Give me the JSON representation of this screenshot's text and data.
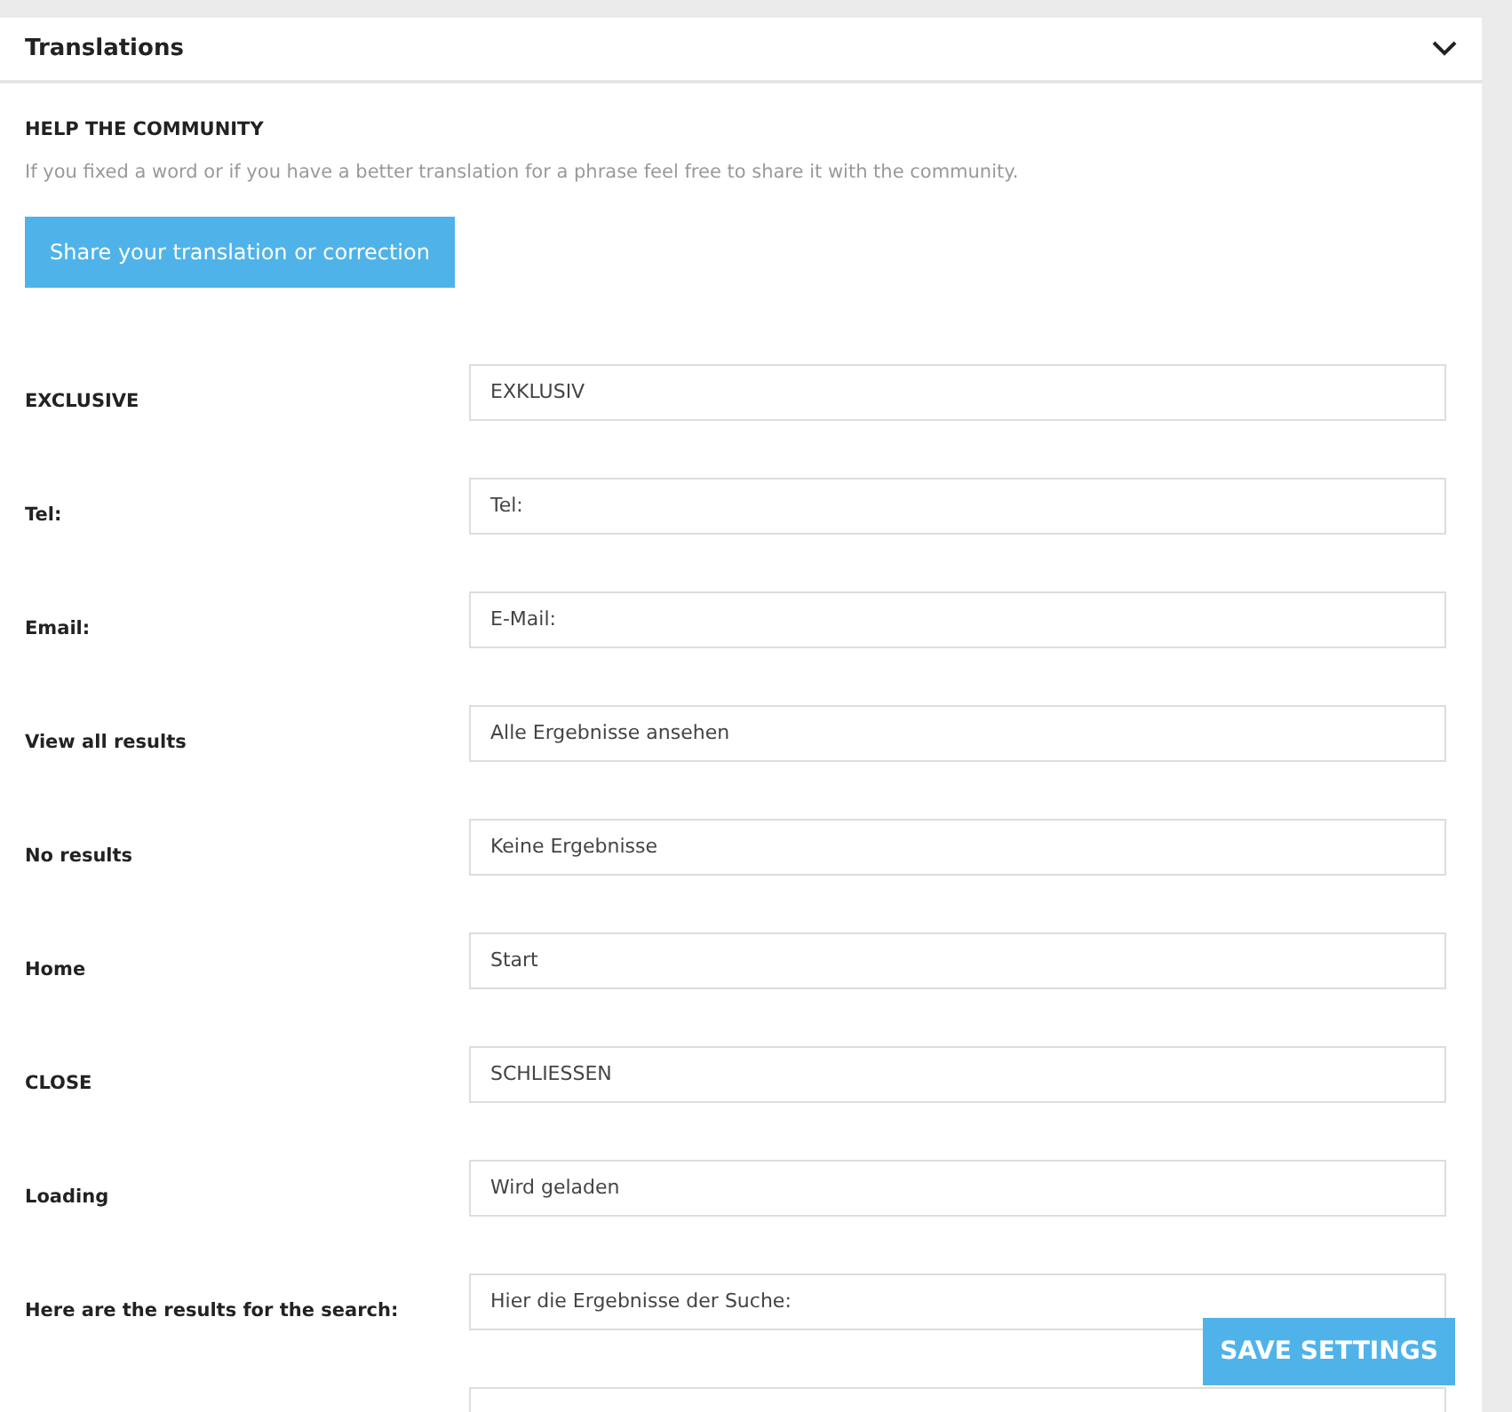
{
  "panel": {
    "title": "Translations",
    "expanded": true
  },
  "help": {
    "heading": "HELP THE COMMUNITY",
    "text": "If you fixed a word or if you have a better translation for a phrase feel free to share it with the community.",
    "button": "Share your translation or correction"
  },
  "rows": [
    {
      "label": "EXCLUSIVE",
      "value": "EXKLUSIV"
    },
    {
      "label": "Tel:",
      "value": "Tel:"
    },
    {
      "label": "Email:",
      "value": "E-Mail:"
    },
    {
      "label": "View all results",
      "value": "Alle Ergebnisse ansehen"
    },
    {
      "label": "No results",
      "value": "Keine Ergebnisse"
    },
    {
      "label": "Home",
      "value": "Start"
    },
    {
      "label": "CLOSE",
      "value": "SCHLIESSEN"
    },
    {
      "label": "Loading",
      "value": "Wird geladen"
    },
    {
      "label": "Here are the results for the search:",
      "value": "Hier die Ergebnisse der Suche:"
    },
    {
      "value": ""
    }
  ],
  "save_button": "SAVE SETTINGS"
}
